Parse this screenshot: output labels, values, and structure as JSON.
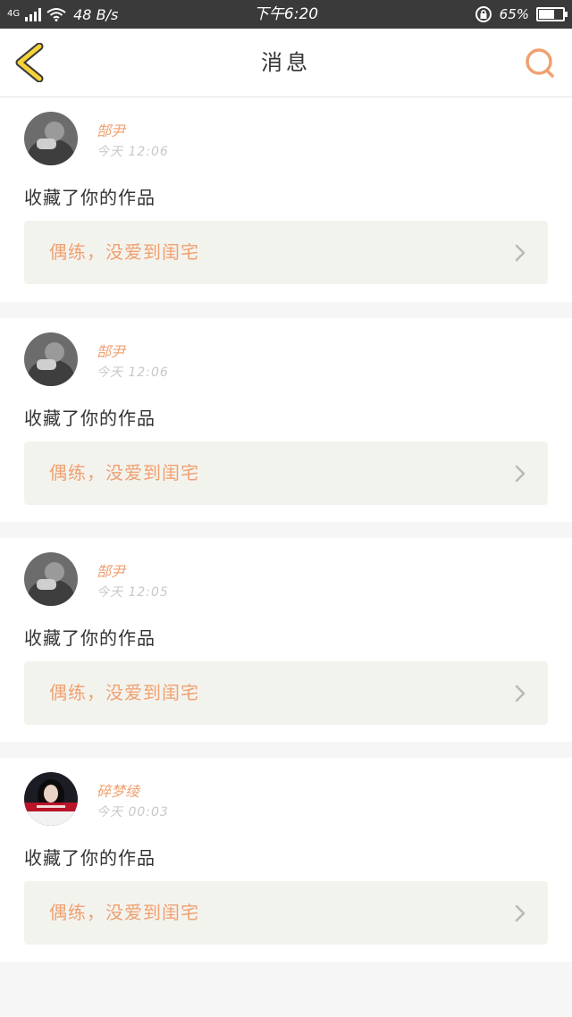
{
  "status_bar": {
    "network": "4G",
    "speed": "48 B/s",
    "time": "下午6:20",
    "battery": "65%",
    "battery_level": 0.65
  },
  "header": {
    "title": "消息"
  },
  "messages": [
    {
      "user": "郜尹",
      "time": "今天 12:06",
      "action": "收藏了你的作品",
      "work": "偶练，没爱到闺宅",
      "avatar": "gray"
    },
    {
      "user": "郜尹",
      "time": "今天 12:06",
      "action": "收藏了你的作品",
      "work": "偶练，没爱到闺宅",
      "avatar": "gray"
    },
    {
      "user": "郜尹",
      "time": "今天 12:05",
      "action": "收藏了你的作品",
      "work": "偶练，没爱到闺宅",
      "avatar": "gray"
    },
    {
      "user": "碎梦绫",
      "time": "今天 00:03",
      "action": "收藏了你的作品",
      "work": "偶练，没爱到闺宅",
      "avatar": "red"
    }
  ],
  "colors": {
    "accent": "#f0a070",
    "back_icon": "#f5d23a",
    "status_bar": "#3a3a3a"
  },
  "icons": {
    "back": "chevron-left-icon",
    "search": "search-icon",
    "arrow": "chevron-right-icon"
  }
}
